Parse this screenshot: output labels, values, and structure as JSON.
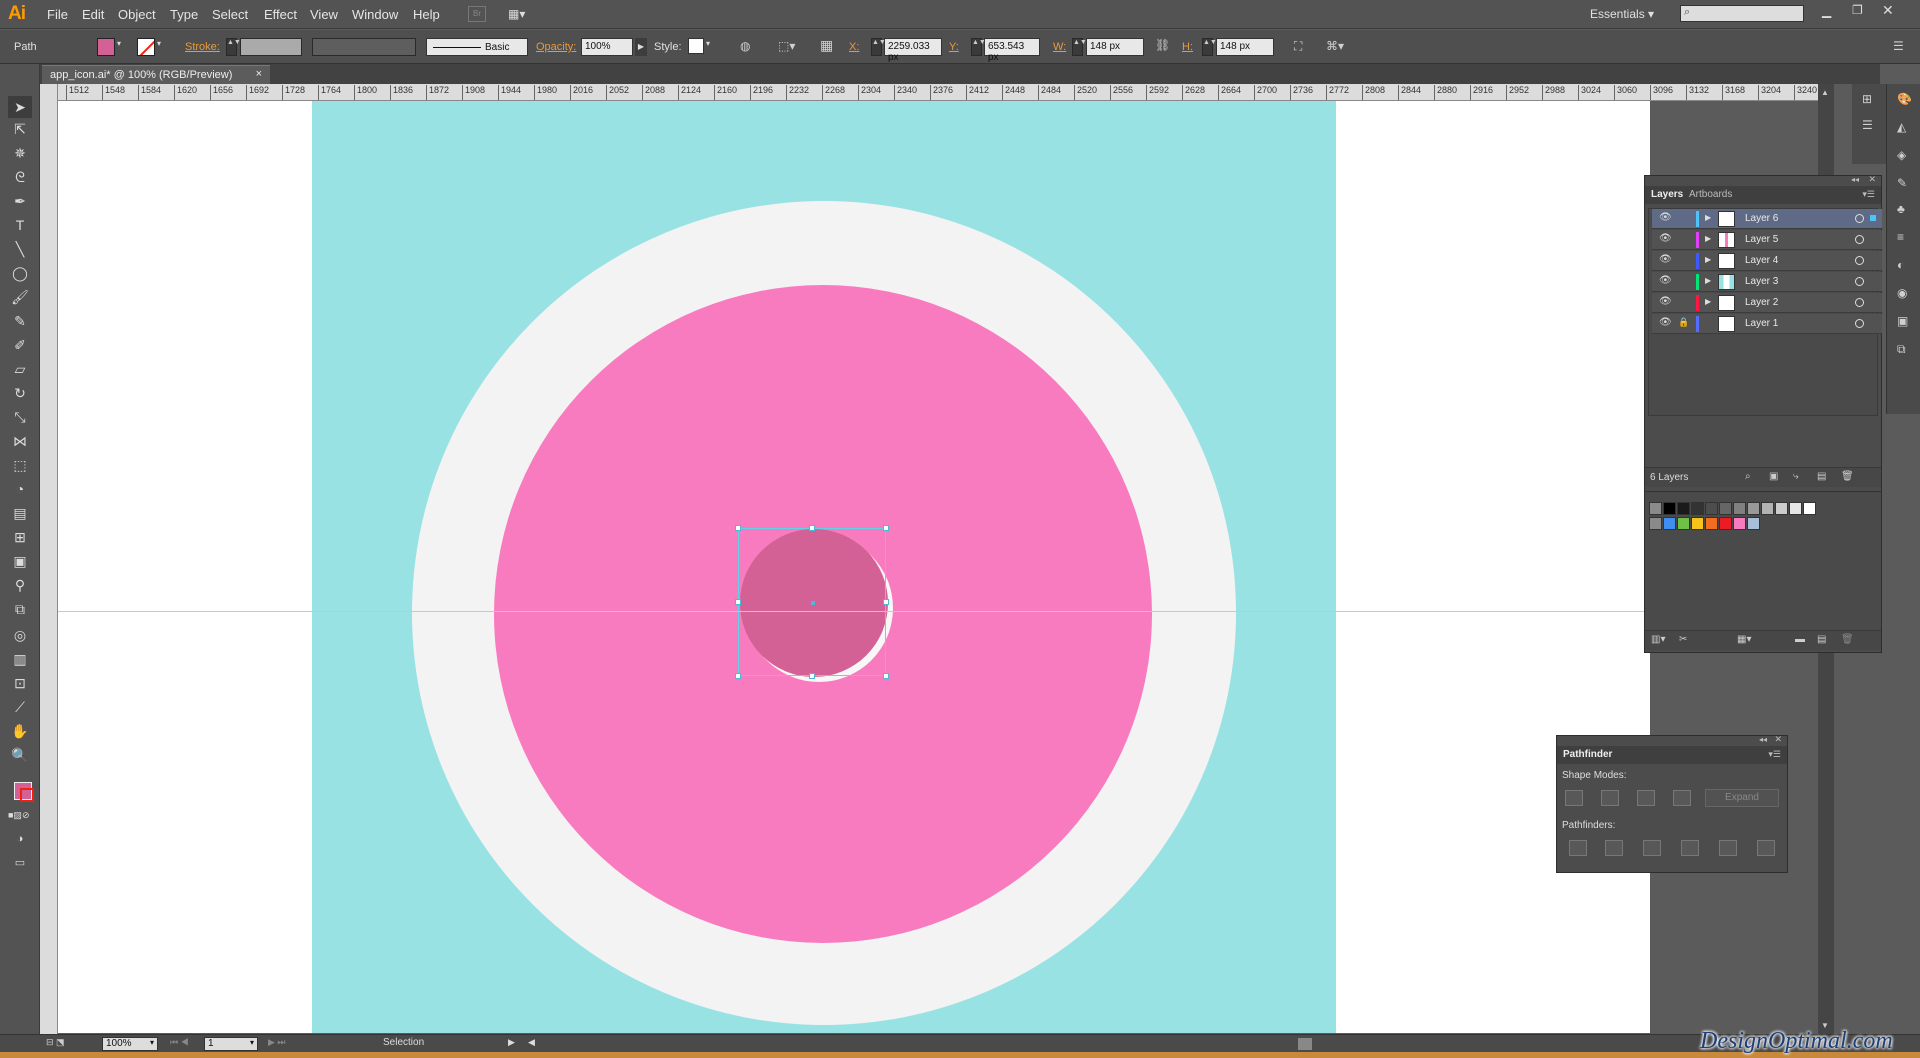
{
  "menubar": {
    "logo": "Ai",
    "items": [
      "File",
      "Edit",
      "Object",
      "Type",
      "Select",
      "Effect",
      "View",
      "Window",
      "Help"
    ],
    "workspace": "Essentials",
    "br_label": "Br"
  },
  "control": {
    "selection_type": "Path",
    "stroke_label": "Stroke:",
    "brush_label": "Basic",
    "opacity_label": "Opacity:",
    "opacity_value": "100%",
    "style_label": "Style:",
    "x_label": "X:",
    "x_value": "2259.033 px",
    "y_label": "Y:",
    "y_value": "653.543 px",
    "w_label": "W:",
    "w_value": "148 px",
    "h_label": "H:",
    "h_value": "148 px",
    "fill_color": "#d36195"
  },
  "document": {
    "tab_title": "app_icon.ai* @ 100% (RGB/Preview)",
    "close": "×"
  },
  "ruler": {
    "ticks": [
      "1512",
      "1548",
      "1584",
      "1620",
      "1656",
      "1692",
      "1728",
      "1764",
      "1800",
      "1836",
      "1872",
      "1908",
      "1944",
      "1980",
      "2016",
      "2052",
      "2088",
      "2124",
      "2160",
      "2196",
      "2232",
      "2268",
      "2304",
      "2340",
      "2376",
      "2412",
      "2448",
      "2484",
      "2520",
      "2556",
      "2592",
      "2628",
      "2664",
      "2700",
      "2736",
      "2772",
      "2808",
      "2844",
      "2880",
      "2916",
      "2952",
      "2988",
      "3024",
      "3060",
      "3096",
      "3132",
      "3168",
      "3204",
      "3240"
    ]
  },
  "artwork": {
    "background": "#98e2e4",
    "ring": "#f3f3f3",
    "circle": "#f97bbf",
    "small_circle": "#d36195"
  },
  "layers": {
    "tabs": [
      "Layers",
      "Artboards"
    ],
    "rows": [
      {
        "name": "Layer 6",
        "color": "#4fc3f7",
        "selected": true
      },
      {
        "name": "Layer 5",
        "color": "#e040fb",
        "selected": false
      },
      {
        "name": "Layer 4",
        "color": "#3d5afe",
        "selected": false
      },
      {
        "name": "Layer 3",
        "color": "#00e676",
        "selected": false
      },
      {
        "name": "Layer 2",
        "color": "#ff1744",
        "selected": false
      },
      {
        "name": "Layer 1",
        "color": "#536dfe",
        "selected": false
      }
    ],
    "count": "6 Layers"
  },
  "swatches": {
    "row1": [
      "#000000",
      "#1a1a1a",
      "#333333",
      "#4d4d4d",
      "#666666",
      "#808080",
      "#999999",
      "#b3b3b3",
      "#cccccc",
      "#e6e6e6",
      "#ffffff"
    ],
    "row2": [
      "#3f8ff0",
      "#6ec046",
      "#f7c21a",
      "#f36d21",
      "#ed1c24",
      "#f97bbf",
      "#a7bfd9"
    ]
  },
  "pathfinder": {
    "title": "Pathfinder",
    "shape_modes": "Shape Modes:",
    "pathfinders": "Pathfinders:",
    "expand": "Expand"
  },
  "status": {
    "zoom": "100%",
    "artboard": "1",
    "mode": "Selection"
  },
  "watermark": "DesignOptimal.com"
}
